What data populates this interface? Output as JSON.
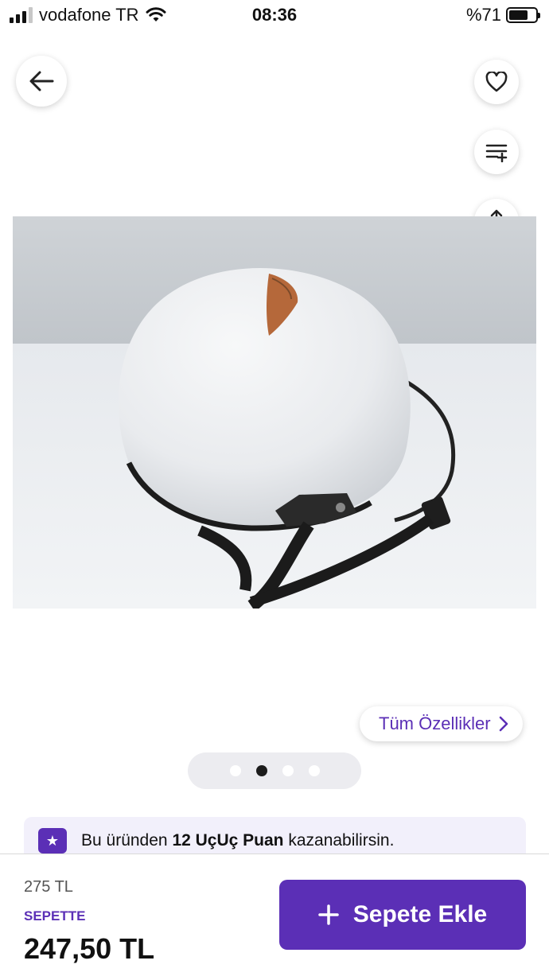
{
  "status_bar": {
    "carrier": "vodafone TR",
    "time": "08:36",
    "battery": "%71",
    "battery_level": 0.71
  },
  "actions": {
    "back_icon": "arrow-left-icon",
    "favorite_icon": "heart-icon",
    "compare_icon": "list-add-icon",
    "share_icon": "share-icon",
    "cart_icon": "cart-icon"
  },
  "gallery": {
    "page_count": 4,
    "active_index": 1
  },
  "specs_link": {
    "label": "Tüm Özellikler"
  },
  "points_banner": {
    "prefix": "Bu üründen ",
    "highlight": "12 UçUç Puan",
    "suffix": " kazanabilirsin."
  },
  "purchase": {
    "old_price": "275 TL",
    "cart_label": "SEPETTE",
    "price": "247,50 TL",
    "add_button": "Sepete Ekle"
  },
  "colors": {
    "accent": "#5b2fb6",
    "banner_bg": "#f2f0fb"
  }
}
